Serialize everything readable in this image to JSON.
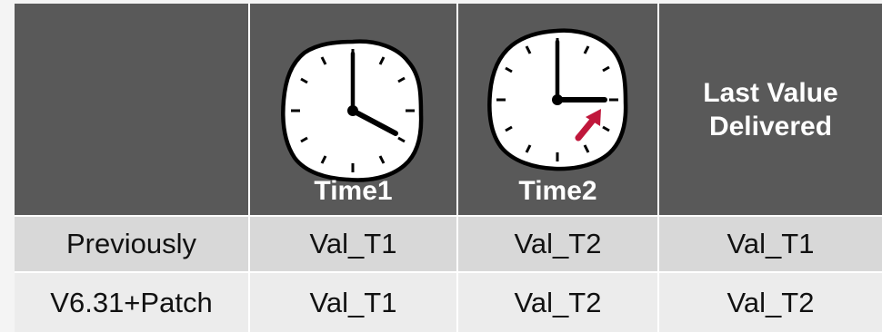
{
  "header": {
    "time1_label": "Time1",
    "time2_label": "Time2",
    "last_value_label": "Last Value\nDelivered",
    "clock_icon": "clock-icon",
    "arrow_icon": "arrow-icon"
  },
  "rows": [
    {
      "label": "Previously",
      "time1": "Val_T1",
      "time2": "Val_T2",
      "last": "Val_T1"
    },
    {
      "label": "V6.31+Patch",
      "time1": "Val_T1",
      "time2": "Val_T2",
      "last": "Val_T2"
    }
  ],
  "colors": {
    "header_bg": "#595959",
    "row1_bg": "#d8d8d8",
    "row2_bg": "#ececec",
    "arrow": "#c0173b"
  }
}
